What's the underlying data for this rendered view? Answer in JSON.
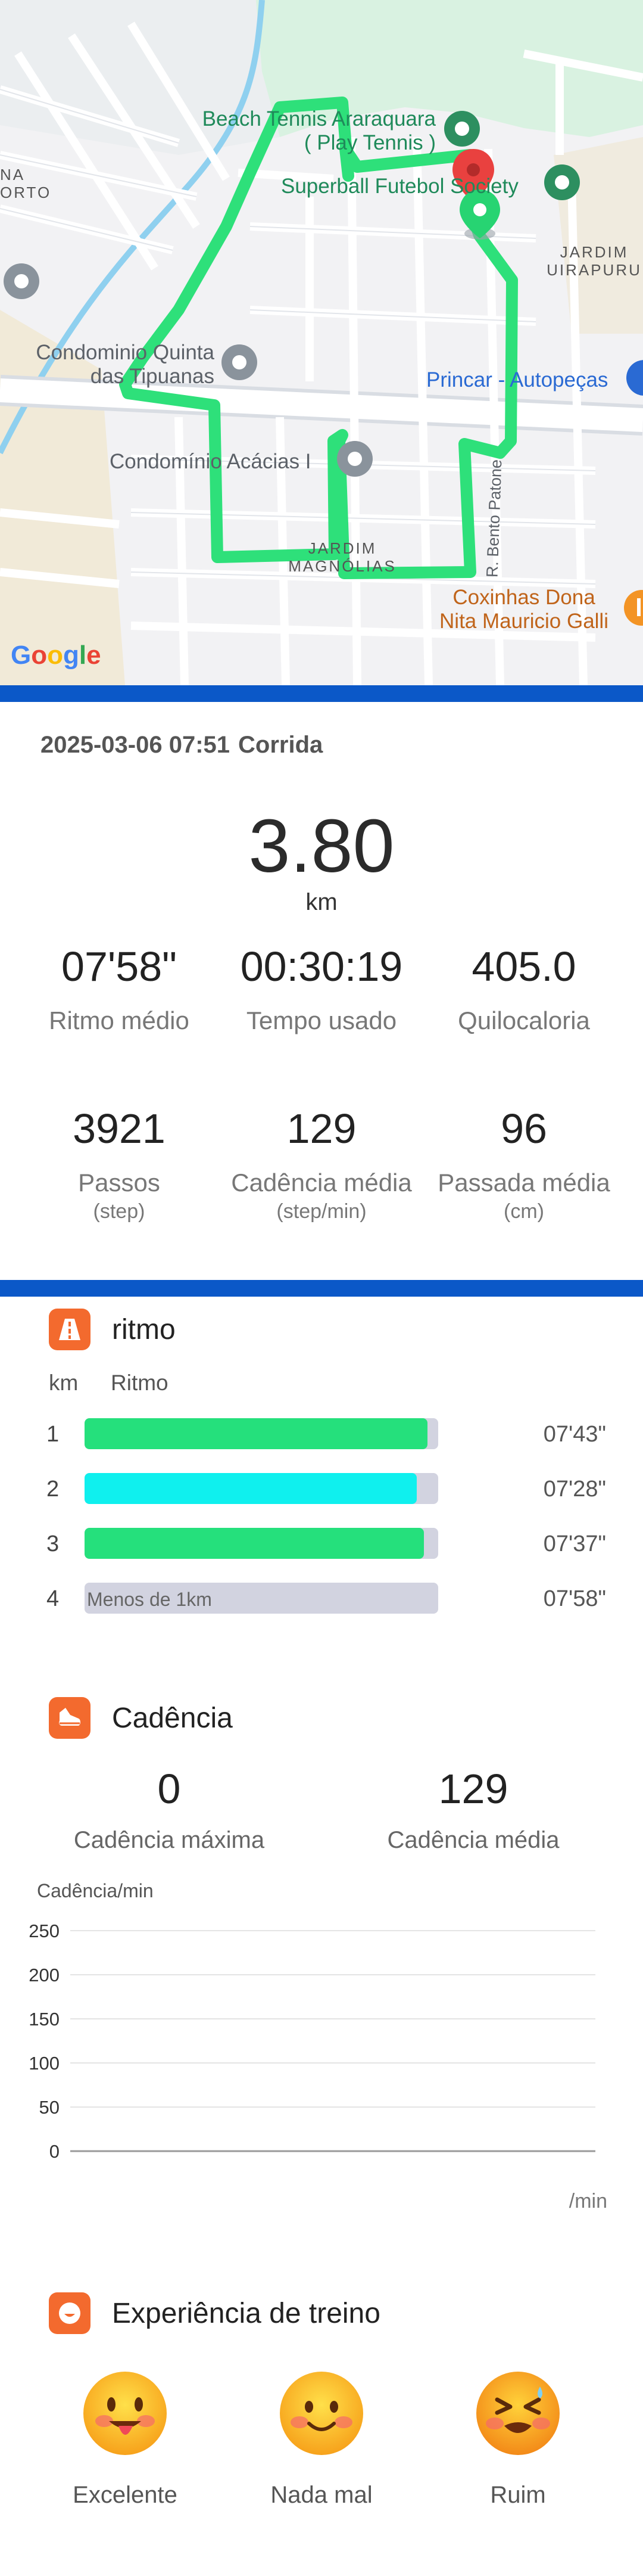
{
  "map": {
    "labels": {
      "beach_tennis_line1": "Beach Tennis Araraquara",
      "beach_tennis_line2": "( Play Tennis )",
      "superball": "Superball Futebol Society",
      "na_orto_line1": "NA",
      "na_orto_line2": "ORTO",
      "jardim_uirapuru_line1": "JARDIM",
      "jardim_uirapuru_line2": "UIRAPURU",
      "condominio_quinta_line1": "Condominio Quinta",
      "condominio_quinta_line2": "das Tipuanas",
      "princar": "Princar - Autopeças",
      "condominio_acacias": "Condomínio Acácias I",
      "rua_bento_patone": "R. Bento Patone",
      "jardim_magnolias_line1": "JARDIM",
      "jardim_magnolias_line2": "MAGNÓLIAS",
      "coxinhas_line1": "Coxinhas Dona",
      "coxinhas_line2": "Nita Mauricio Galli"
    },
    "logo": "Google",
    "route_color": "#2ee07a"
  },
  "summary": {
    "date": "2025-03-06 07:51",
    "activity": "Corrida",
    "distance": "3.80",
    "distance_unit": "km",
    "stats_row1": [
      {
        "value": "07'58\"",
        "label": "Ritmo médio"
      },
      {
        "value": "00:30:19",
        "label": "Tempo usado"
      },
      {
        "value": "405.0",
        "label": "Quilocaloria"
      }
    ],
    "stats_row2": [
      {
        "value": "3921",
        "label": "Passos",
        "unit": "(step)"
      },
      {
        "value": "129",
        "label": "Cadência média",
        "unit": "(step/min)"
      },
      {
        "value": "96",
        "label": "Passada média",
        "unit": "(cm)"
      }
    ]
  },
  "pace": {
    "title": "ritmo",
    "col_km": "km",
    "col_pace": "Ritmo",
    "rows": [
      {
        "km": "1",
        "value": "07'43\"",
        "fill": 0.97,
        "color": "#25e07c",
        "note": ""
      },
      {
        "km": "2",
        "value": "07'28\"",
        "fill": 0.94,
        "color": "#0ff0ee",
        "note": ""
      },
      {
        "km": "3",
        "value": "07'37\"",
        "fill": 0.96,
        "color": "#25e07c",
        "note": ""
      },
      {
        "km": "4",
        "value": "07'58\"",
        "fill": 0,
        "color": "#d2d3e0",
        "note": "Menos de 1km"
      }
    ]
  },
  "cadence": {
    "title": "Cadência",
    "max_value": "0",
    "max_label": "Cadência máxima",
    "avg_value": "129",
    "avg_label": "Cadência média",
    "chart_ylabel": "Cadência/min",
    "chart_xlabel": "/min",
    "chart_data": {
      "type": "line",
      "title": "",
      "ylabel": "Cadência/min",
      "xlabel": "/min",
      "yticks": [
        "250",
        "200",
        "150",
        "100",
        "50",
        "0"
      ],
      "ylim": [
        0,
        250
      ],
      "grid": true,
      "series": []
    }
  },
  "experience": {
    "title": "Experiência de treino",
    "options": [
      {
        "label": "Excelente",
        "icon": "tongue-out-face-icon"
      },
      {
        "label": "Nada mal",
        "icon": "smiling-face-icon"
      },
      {
        "label": "Ruim",
        "icon": "tired-face-icon"
      }
    ]
  },
  "colors": {
    "accent_orange": "#f36a2e",
    "divider_blue": "#0b58c8",
    "pace_green": "#25e07c",
    "pace_cyan": "#0ff0ee"
  }
}
